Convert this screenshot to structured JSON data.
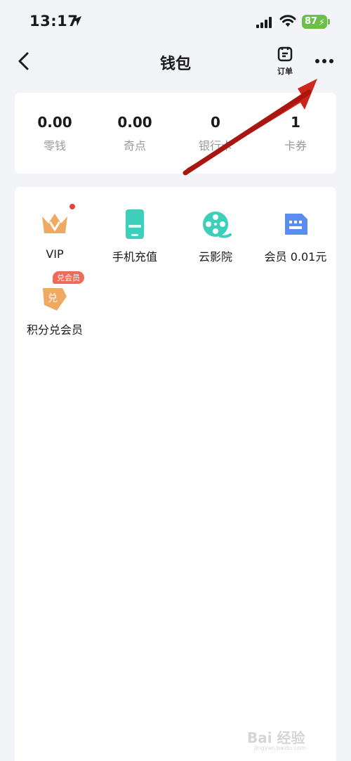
{
  "status_bar": {
    "time": "13:17",
    "battery": "87"
  },
  "nav": {
    "title": "钱包",
    "orders_label": "订单"
  },
  "balances": [
    {
      "value": "0.00",
      "label": "零钱"
    },
    {
      "value": "0.00",
      "label": "奇点"
    },
    {
      "value": "0",
      "label": "银行卡"
    },
    {
      "value": "1",
      "label": "卡券"
    }
  ],
  "services": [
    {
      "label": "VIP",
      "icon": "crown-icon",
      "has_dot": true
    },
    {
      "label": "手机充值",
      "icon": "phone-icon"
    },
    {
      "label": "云影院",
      "icon": "film-reel-icon"
    },
    {
      "label": "会员 0.01元",
      "icon": "card-icon"
    },
    {
      "label": "积分兑会员",
      "icon": "exchange-icon",
      "badge": "兑会员",
      "icon_text": "兑"
    }
  ],
  "colors": {
    "accent_teal": "#3ccfb9",
    "crown": "#f0a960",
    "card_blue": "#5b8cf0",
    "arrow_red": "#c0211b",
    "dot_red": "#e8403a"
  },
  "watermark": {
    "text": "Bai 经验",
    "url": "jingyan.baidu.com"
  }
}
